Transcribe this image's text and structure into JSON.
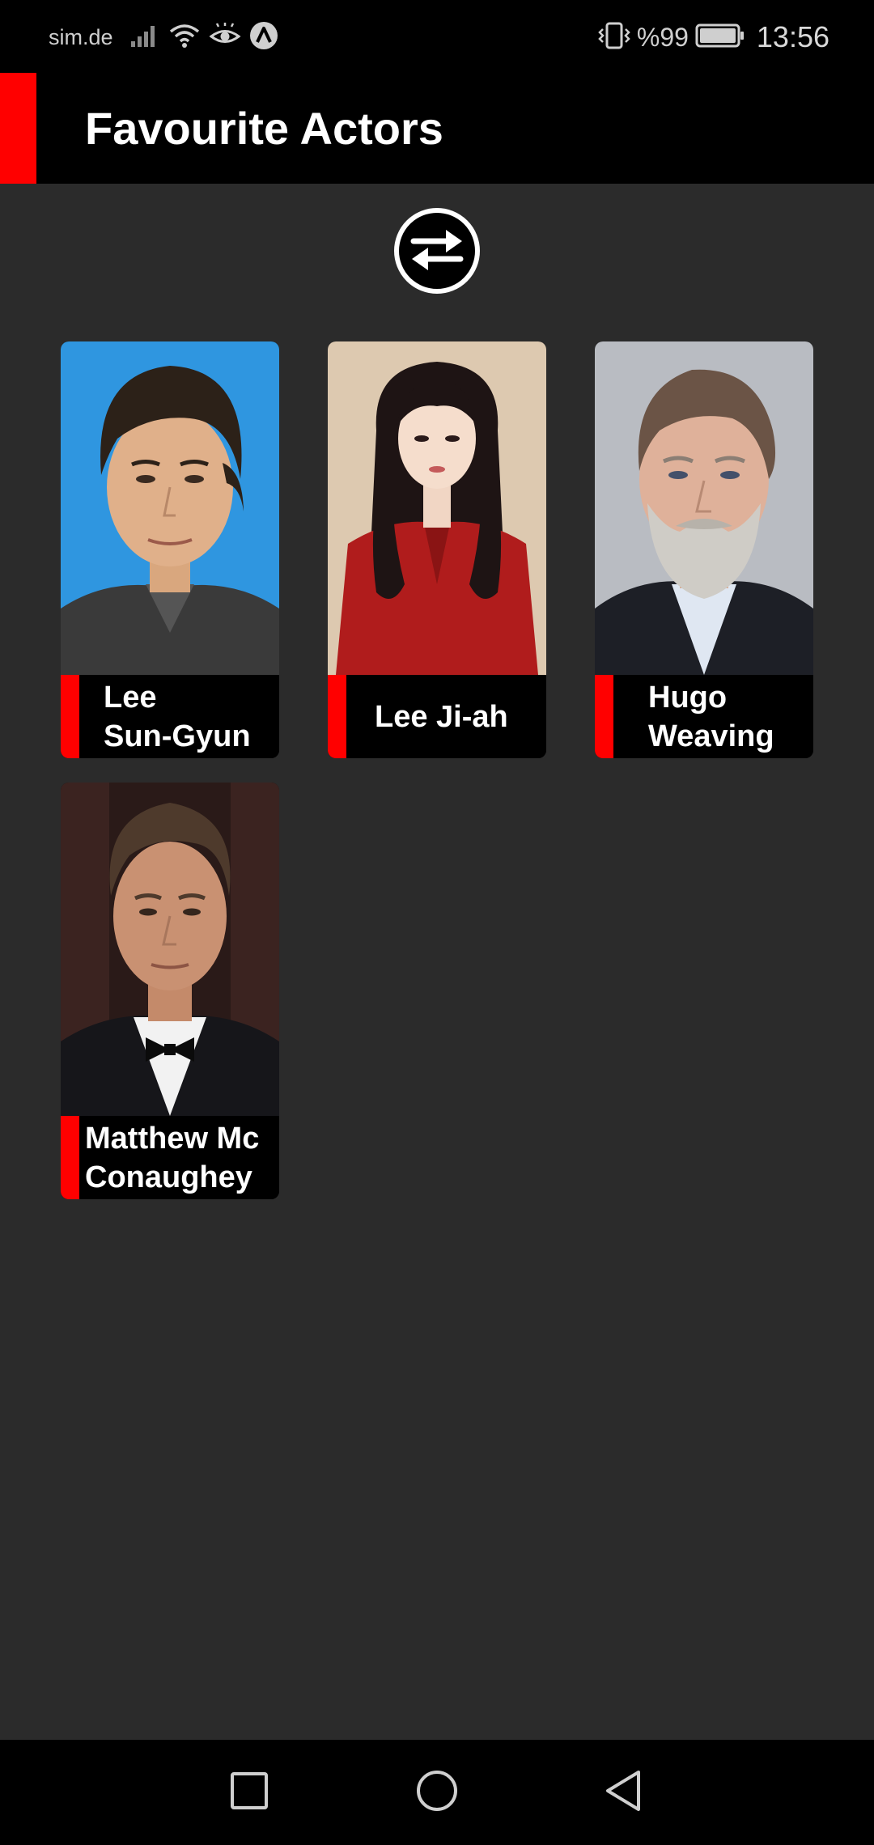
{
  "status_bar": {
    "carrier": "sim.de",
    "battery_percent": "%99",
    "time": "13:56",
    "icons": [
      "signal-icon",
      "wifi-icon",
      "eye-comfort-icon",
      "app-notification-icon",
      "vibrate-icon",
      "battery-icon"
    ]
  },
  "app_bar": {
    "title": "Favourite Actors",
    "accent_color": "#ff0000"
  },
  "toolbar": {
    "swap_icon": "swap-arrows-icon"
  },
  "actors": [
    {
      "name_line1": "Lee",
      "name_line2": "Sun-Gyun"
    },
    {
      "name_line1": "Lee Ji-ah",
      "name_line2": ""
    },
    {
      "name_line1": "Hugo",
      "name_line2": "Weaving"
    },
    {
      "name_line1": "Matthew Mc",
      "name_line2": "Conaughey"
    }
  ],
  "nav_bar": {
    "icons": [
      "recents-square-icon",
      "home-circle-icon",
      "back-triangle-icon"
    ]
  },
  "colors": {
    "background": "#2b2b2b",
    "bar": "#000000",
    "accent": "#ff0000",
    "text": "#ffffff"
  }
}
